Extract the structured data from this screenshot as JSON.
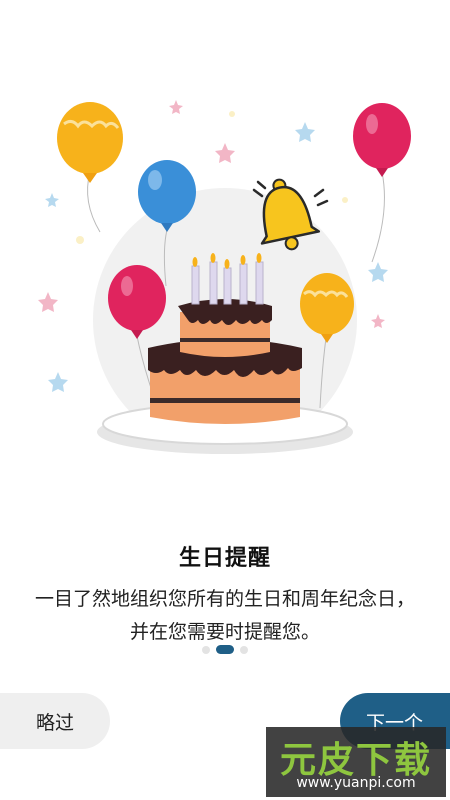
{
  "onboarding": {
    "title": "生日提醒",
    "description": "一目了然地组织您所有的生日和周年纪念日，并在您需要时提醒您。",
    "page_indicator": {
      "total": 3,
      "current": 2
    }
  },
  "buttons": {
    "skip_label": "略过",
    "next_label": "下一个"
  },
  "watermark": {
    "brand": "元皮下载",
    "url": "www.yuanpi.com"
  },
  "colors": {
    "accent": "#1f5f87",
    "skip_bg": "#efefef",
    "balloon_yellow": "#f7b21b",
    "balloon_blue": "#3a8fd8",
    "balloon_pink": "#e0245e",
    "bell": "#f7c51e"
  },
  "icons": [
    "bell-icon",
    "birthday-cake-icon",
    "balloon-icon",
    "star-icon"
  ]
}
